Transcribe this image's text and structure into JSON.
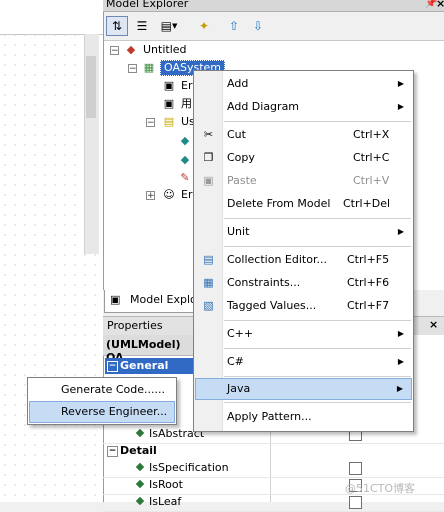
{
  "model_explorer": {
    "title": "Model Explorer",
    "tab_label": "Model Explor",
    "tree": [
      {
        "label": "Untitled"
      },
      {
        "label": "OASystem"
      },
      {
        "label": "Er"
      },
      {
        "label": "用"
      },
      {
        "label": "Us"
      },
      {
        "label": ""
      },
      {
        "label": ""
      },
      {
        "label": ""
      },
      {
        "label": "Er"
      }
    ]
  },
  "properties": {
    "title": "Properties",
    "header": "(UMLModel) OA",
    "categories": {
      "general": "General",
      "detail": "Detail"
    },
    "rows": [
      {
        "label": "IsAbstract"
      },
      {
        "label": "IsSpecification"
      },
      {
        "label": "IsRoot"
      },
      {
        "label": "IsLeaf"
      }
    ]
  },
  "context_menu": {
    "items": [
      {
        "label": "Add"
      },
      {
        "label": "Add Diagram"
      },
      {
        "label": "Cut",
        "shortcut": "Ctrl+X"
      },
      {
        "label": "Copy",
        "shortcut": "Ctrl+C"
      },
      {
        "label": "Paste",
        "shortcut": "Ctrl+V"
      },
      {
        "label": "Delete From Model",
        "shortcut": "Ctrl+Del"
      },
      {
        "label": "Unit"
      },
      {
        "label": "Collection Editor...",
        "shortcut": "Ctrl+F5"
      },
      {
        "label": "Constraints...",
        "shortcut": "Ctrl+F6"
      },
      {
        "label": "Tagged Values...",
        "shortcut": "Ctrl+F7"
      },
      {
        "label": "C++"
      },
      {
        "label": "C#"
      },
      {
        "label": "Java"
      },
      {
        "label": "Apply Pattern..."
      }
    ]
  },
  "java_submenu": {
    "items": [
      {
        "label": "Generate Code......"
      },
      {
        "label": "Reverse Engineer..."
      }
    ]
  },
  "watermark": "@51CTO博客",
  "colors": {
    "selection": "#316ac5",
    "menu_highlight": "#c6dcf5"
  }
}
